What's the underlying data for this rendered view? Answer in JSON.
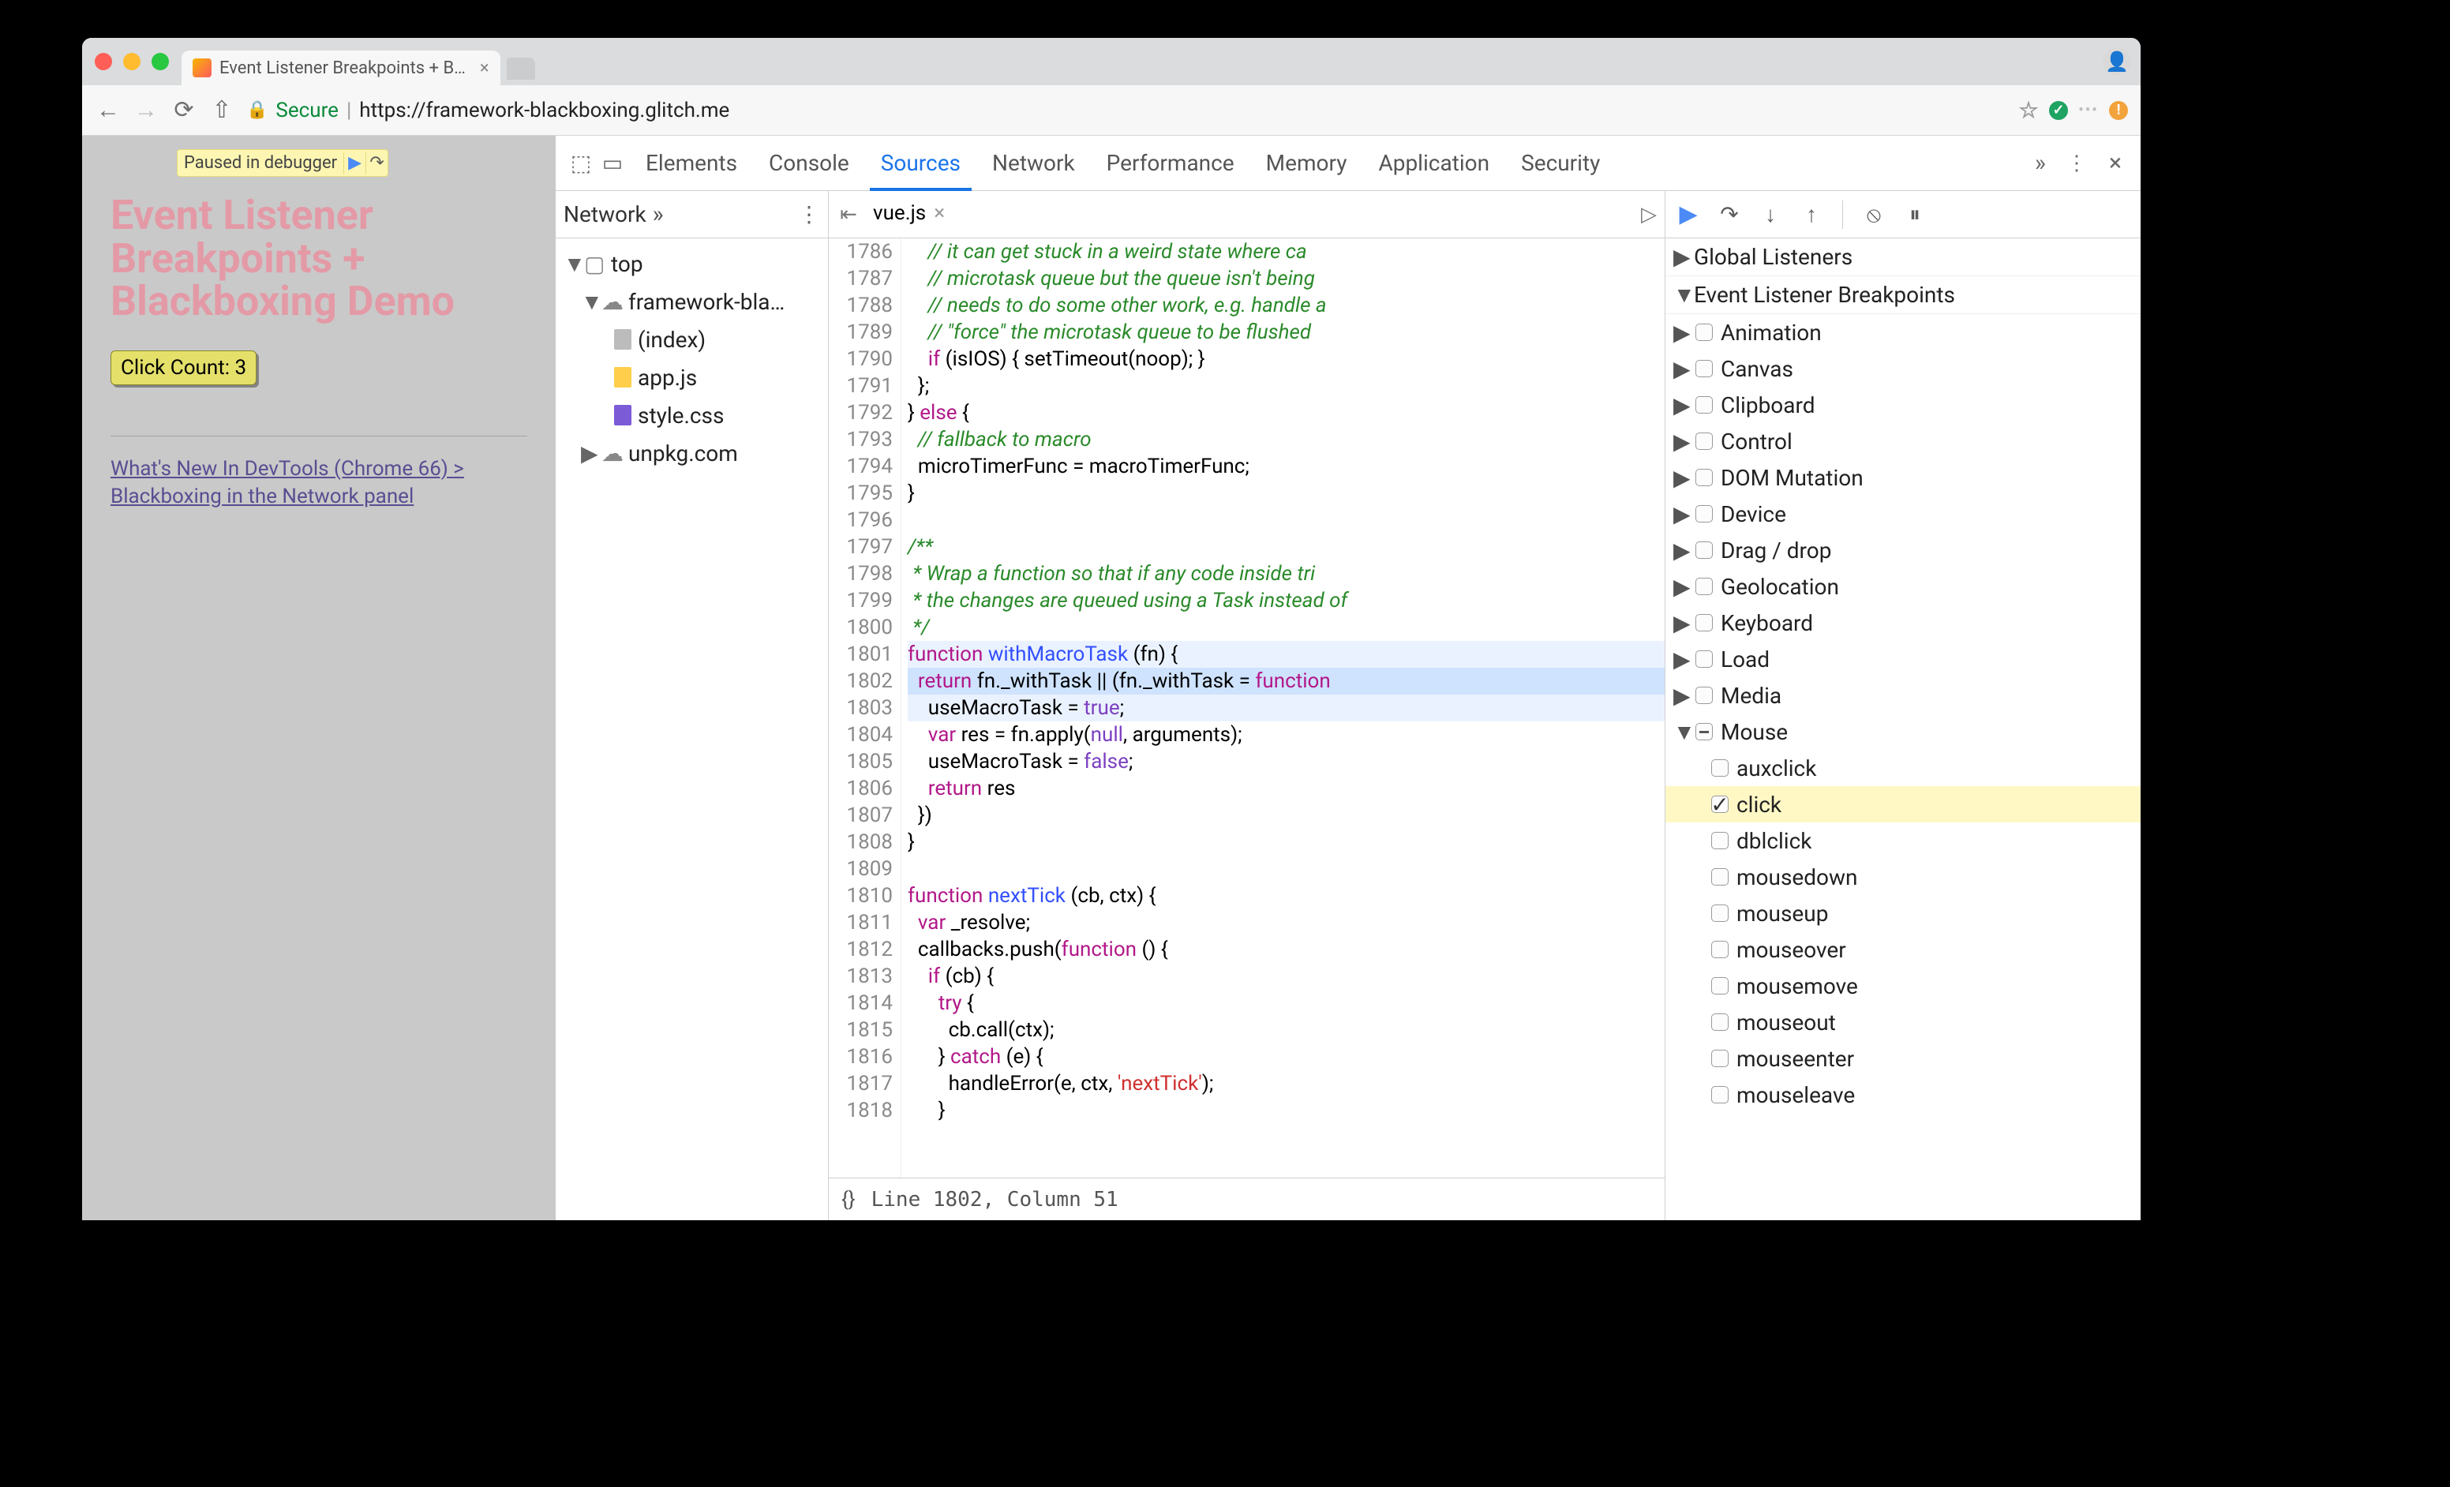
{
  "browser": {
    "tab_title": "Event Listener Breakpoints + B…",
    "secure_label": "Secure",
    "url_display": "https://framework-blackboxing.glitch.me"
  },
  "page": {
    "paused_label": "Paused in debugger",
    "title_line1": "Event Listener",
    "title_line2": "Breakpoints +",
    "title_line3": "Blackboxing Demo",
    "click_button": "Click Count: 3",
    "whatsnew_link": "What's New In DevTools (Chrome 66) > Blackboxing in the Network panel"
  },
  "devtools": {
    "main_tabs": [
      "Elements",
      "Console",
      "Sources",
      "Network",
      "Performance",
      "Memory",
      "Application",
      "Security"
    ],
    "active_main_tab": "Sources",
    "nav": {
      "header_tab": "Network",
      "tree": {
        "top": "top",
        "host": "framework-bla…",
        "files": [
          "(index)",
          "app.js",
          "style.css"
        ],
        "cdn": "unpkg.com"
      }
    },
    "editor": {
      "file_name": "vue.js",
      "status_pos": "Line 1802, Column 51",
      "first_line_no": 1786,
      "lines": [
        {
          "cls": "cm-c",
          "t": "    // it can get stuck in a weird state where ca"
        },
        {
          "cls": "cm-c",
          "t": "    // microtask queue but the queue isn't being"
        },
        {
          "cls": "cm-c",
          "t": "    // needs to do some other work, e.g. handle a"
        },
        {
          "cls": "cm-c",
          "t": "    // \"force\" the microtask queue to be flushed"
        },
        {
          "cls": "",
          "t": "    <span class='cm-k'>if</span> (isIOS) { setTimeout(noop); }"
        },
        {
          "cls": "",
          "t": "  };"
        },
        {
          "cls": "",
          "t": "} <span class='cm-k'>else</span> {"
        },
        {
          "cls": "cm-c",
          "t": "  // fallback to macro"
        },
        {
          "cls": "",
          "t": "  microTimerFunc = macroTimerFunc;"
        },
        {
          "cls": "",
          "t": "}"
        },
        {
          "cls": "",
          "t": ""
        },
        {
          "cls": "cm-c",
          "t": "/**"
        },
        {
          "cls": "cm-c",
          "t": " * Wrap a function so that if any code inside tri"
        },
        {
          "cls": "cm-c",
          "t": " * the changes are queued using a Task instead of"
        },
        {
          "cls": "cm-c",
          "t": " */"
        },
        {
          "cls": "",
          "hl": true,
          "t": "<span class='cm-k'>function</span> <span class='cm-f'>withMacroTask</span> (fn) {"
        },
        {
          "cls": "",
          "exec": true,
          "t": "  <span class='cm-k'>return</span> fn._withTask || (fn._withTask = <span class='cm-k'>function</span>"
        },
        {
          "cls": "",
          "hl": true,
          "t": "    useMacroTask = <span class='cm-nb'>true</span>;"
        },
        {
          "cls": "",
          "t": "    <span class='cm-k'>var</span> res = fn.apply(<span class='cm-nb'>null</span>, arguments);"
        },
        {
          "cls": "",
          "t": "    useMacroTask = <span class='cm-nb'>false</span>;"
        },
        {
          "cls": "",
          "t": "    <span class='cm-k'>return</span> res"
        },
        {
          "cls": "",
          "t": "  })"
        },
        {
          "cls": "",
          "t": "}"
        },
        {
          "cls": "",
          "t": ""
        },
        {
          "cls": "",
          "t": "<span class='cm-k'>function</span> <span class='cm-f'>nextTick</span> (cb, ctx) {"
        },
        {
          "cls": "",
          "t": "  <span class='cm-k'>var</span> _resolve;"
        },
        {
          "cls": "",
          "t": "  callbacks.push(<span class='cm-k'>function</span> () {"
        },
        {
          "cls": "",
          "t": "    <span class='cm-k'>if</span> (cb) {"
        },
        {
          "cls": "",
          "t": "      <span class='cm-k'>try</span> {"
        },
        {
          "cls": "",
          "t": "        cb.call(ctx);"
        },
        {
          "cls": "",
          "t": "      } <span class='cm-k'>catch</span> (e) {"
        },
        {
          "cls": "",
          "t": "        handleError(e, ctx, <span class='cm-s'>'nextTick'</span>);"
        },
        {
          "cls": "",
          "t": "      }"
        }
      ]
    },
    "debugger": {
      "sections": {
        "global": "Global Listeners",
        "elb": "Event Listener Breakpoints"
      },
      "categories": [
        {
          "name": "Animation",
          "expanded": false,
          "checked": false
        },
        {
          "name": "Canvas",
          "expanded": false,
          "checked": false
        },
        {
          "name": "Clipboard",
          "expanded": false,
          "checked": false
        },
        {
          "name": "Control",
          "expanded": false,
          "checked": false
        },
        {
          "name": "DOM Mutation",
          "expanded": false,
          "checked": false
        },
        {
          "name": "Device",
          "expanded": false,
          "checked": false
        },
        {
          "name": "Drag / drop",
          "expanded": false,
          "checked": false
        },
        {
          "name": "Geolocation",
          "expanded": false,
          "checked": false
        },
        {
          "name": "Keyboard",
          "expanded": false,
          "checked": false
        },
        {
          "name": "Load",
          "expanded": false,
          "checked": false
        },
        {
          "name": "Media",
          "expanded": false,
          "checked": false
        },
        {
          "name": "Mouse",
          "expanded": true,
          "checked": "mixed",
          "events": [
            {
              "name": "auxclick",
              "checked": false
            },
            {
              "name": "click",
              "checked": true,
              "selected": true
            },
            {
              "name": "dblclick",
              "checked": false
            },
            {
              "name": "mousedown",
              "checked": false
            },
            {
              "name": "mouseup",
              "checked": false
            },
            {
              "name": "mouseover",
              "checked": false
            },
            {
              "name": "mousemove",
              "checked": false
            },
            {
              "name": "mouseout",
              "checked": false
            },
            {
              "name": "mouseenter",
              "checked": false
            },
            {
              "name": "mouseleave",
              "checked": false
            }
          ]
        }
      ]
    }
  }
}
